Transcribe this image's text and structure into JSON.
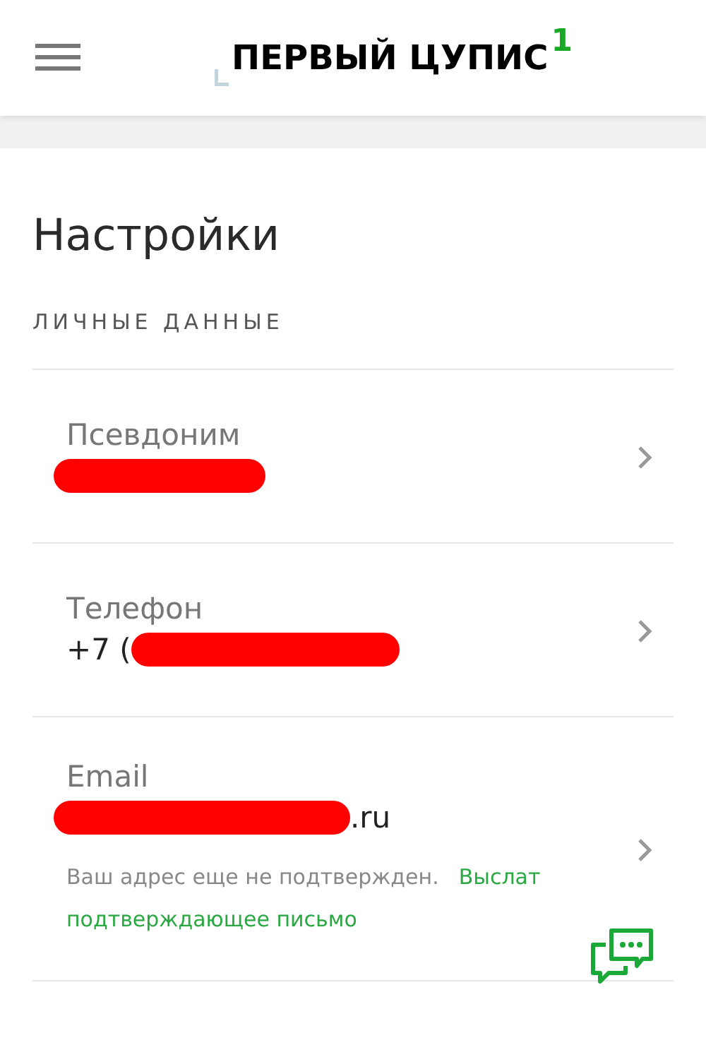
{
  "header": {
    "logo_text": "ПЕРВЫЙ ЦУПИС",
    "logo_mark": "1"
  },
  "page": {
    "title": "Настройки",
    "section": "ЛИЧНЫЕ ДАННЫЕ"
  },
  "fields": [
    {
      "label": "Псевдоним",
      "redacted": true
    },
    {
      "label": "Телефон",
      "value_before": "+7 (",
      "redacted": true
    },
    {
      "label": "Email",
      "value_after": ".ru",
      "redacted": true,
      "note": "Ваш адрес еще не подтвержден.",
      "link_start": "Выслат",
      "link_rest": "подтверждающее письмо"
    }
  ]
}
